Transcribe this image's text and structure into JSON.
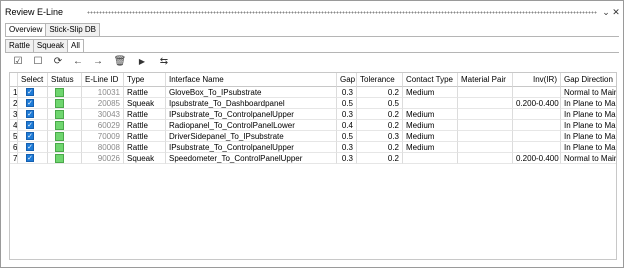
{
  "window": {
    "title": "Review E-Line"
  },
  "top_tabs": [
    "Overview",
    "Stick-Slip DB"
  ],
  "sub_tabs": [
    "Rattle",
    "Squeak",
    "All"
  ],
  "toolbar": [
    "select-all-checkbox-icon",
    "deselect-checkbox-icon",
    "refresh-icon",
    "arrow-left-icon",
    "arrow-right-icon",
    "trash-icon",
    "play-icon",
    "swap-icon"
  ],
  "table": {
    "columns": [
      "",
      "Select",
      "Status",
      "E-Line ID",
      "Type",
      "Interface Name",
      "Gap",
      "Tolerance",
      "Contact Type",
      "Material Pair",
      "Inv(IR)",
      "Gap Direction"
    ],
    "rows": [
      {
        "n": "1",
        "id": "10031",
        "type": "Rattle",
        "name": "GloveBox_To_IPsubstrate",
        "gap": "0.3",
        "tol": "0.2",
        "contact": "Medium",
        "mat": "",
        "inv": "",
        "dir": "Normal to Main"
      },
      {
        "n": "2",
        "id": "20085",
        "type": "Squeak",
        "name": "Ipsubstrate_To_Dashboardpanel",
        "gap": "0.5",
        "tol": "0.5",
        "contact": "",
        "mat": "",
        "inv": "0.200-0.400",
        "dir": "In Plane to Main"
      },
      {
        "n": "3",
        "id": "30043",
        "type": "Rattle",
        "name": "IPsubstrate_To_ControlpanelUpper",
        "gap": "0.3",
        "tol": "0.2",
        "contact": "Medium",
        "mat": "",
        "inv": "",
        "dir": "In Plane to Main"
      },
      {
        "n": "4",
        "id": "60029",
        "type": "Rattle",
        "name": "Radiopanel_To_ControlPanelLower",
        "gap": "0.4",
        "tol": "0.2",
        "contact": "Medium",
        "mat": "",
        "inv": "",
        "dir": "In Plane to Main"
      },
      {
        "n": "5",
        "id": "70009",
        "type": "Rattle",
        "name": "DriverSidepanel_To_IPsubstrate",
        "gap": "0.5",
        "tol": "0.3",
        "contact": "Medium",
        "mat": "",
        "inv": "",
        "dir": "In Plane to Main"
      },
      {
        "n": "6",
        "id": "80008",
        "type": "Rattle",
        "name": "IPsubstrate_To_ControlpanelUpper",
        "gap": "0.3",
        "tol": "0.2",
        "contact": "Medium",
        "mat": "",
        "inv": "",
        "dir": "In Plane to Main"
      },
      {
        "n": "7",
        "id": "90026",
        "type": "Squeak",
        "name": "Speedometer_To_ControlPanelUpper",
        "gap": "0.3",
        "tol": "0.2",
        "contact": "",
        "mat": "",
        "inv": "0.200-0.400",
        "dir": "Normal to Main"
      }
    ]
  },
  "colors": {
    "checkbox": "#1e7bd7",
    "status_ok": "#6fd66f"
  }
}
